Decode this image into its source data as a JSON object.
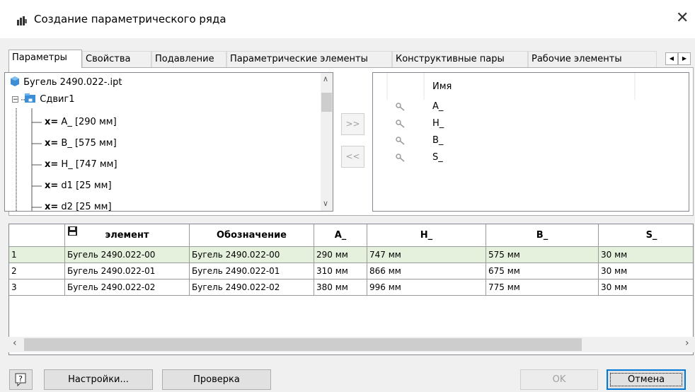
{
  "window": {
    "title": "Создание параметрического ряда"
  },
  "tabs": [
    {
      "label": "Параметры",
      "active": true
    },
    {
      "label": "Свойства"
    },
    {
      "label": "Подавление"
    },
    {
      "label": "Параметрические элементы"
    },
    {
      "label": "Конструктивные пары"
    },
    {
      "label": "Рабочие элементы"
    }
  ],
  "tree": {
    "root": "Бугель 2490.022-.ipt",
    "group": "Сдвиг1",
    "param_prefix": "x=",
    "params": [
      "A_ [290 мм]",
      "B_ [575 мм]",
      "H_ [747 мм]",
      "d1 [25 мм]",
      "d2 [25 мм]"
    ]
  },
  "transfer": {
    "add": ">>",
    "remove": "<<"
  },
  "selected_list": {
    "header": "Имя",
    "items": [
      "A_",
      "H_",
      "B_",
      "S_"
    ]
  },
  "table": {
    "columns": [
      "элемент",
      "Обозначение",
      "A_",
      "H_",
      "B_",
      "S_"
    ],
    "rows": [
      {
        "n": "1",
        "element": "Бугель 2490.022-00",
        "designation": "Бугель 2490.022-00",
        "A": "290 мм",
        "H": "747 мм",
        "B": "575 мм",
        "S": "30 мм"
      },
      {
        "n": "2",
        "element": "Бугель 2490.022-01",
        "designation": "Бугель 2490.022-01",
        "A": "310 мм",
        "H": "866 мм",
        "B": "675 мм",
        "S": "30 мм"
      },
      {
        "n": "3",
        "element": "Бугель 2490.022-02",
        "designation": "Бугель 2490.022-02",
        "A": "380 мм",
        "H": "996 мм",
        "B": "775 мм",
        "S": "30 мм"
      }
    ]
  },
  "buttons": {
    "help": "?",
    "settings": "Настройки...",
    "check": "Проверка",
    "ok": "OK",
    "cancel": "Отмена"
  },
  "colors": {
    "selected_row": "#e5f1dd",
    "focus": "#0078d7",
    "folder_blue": "#3c8fd6"
  }
}
